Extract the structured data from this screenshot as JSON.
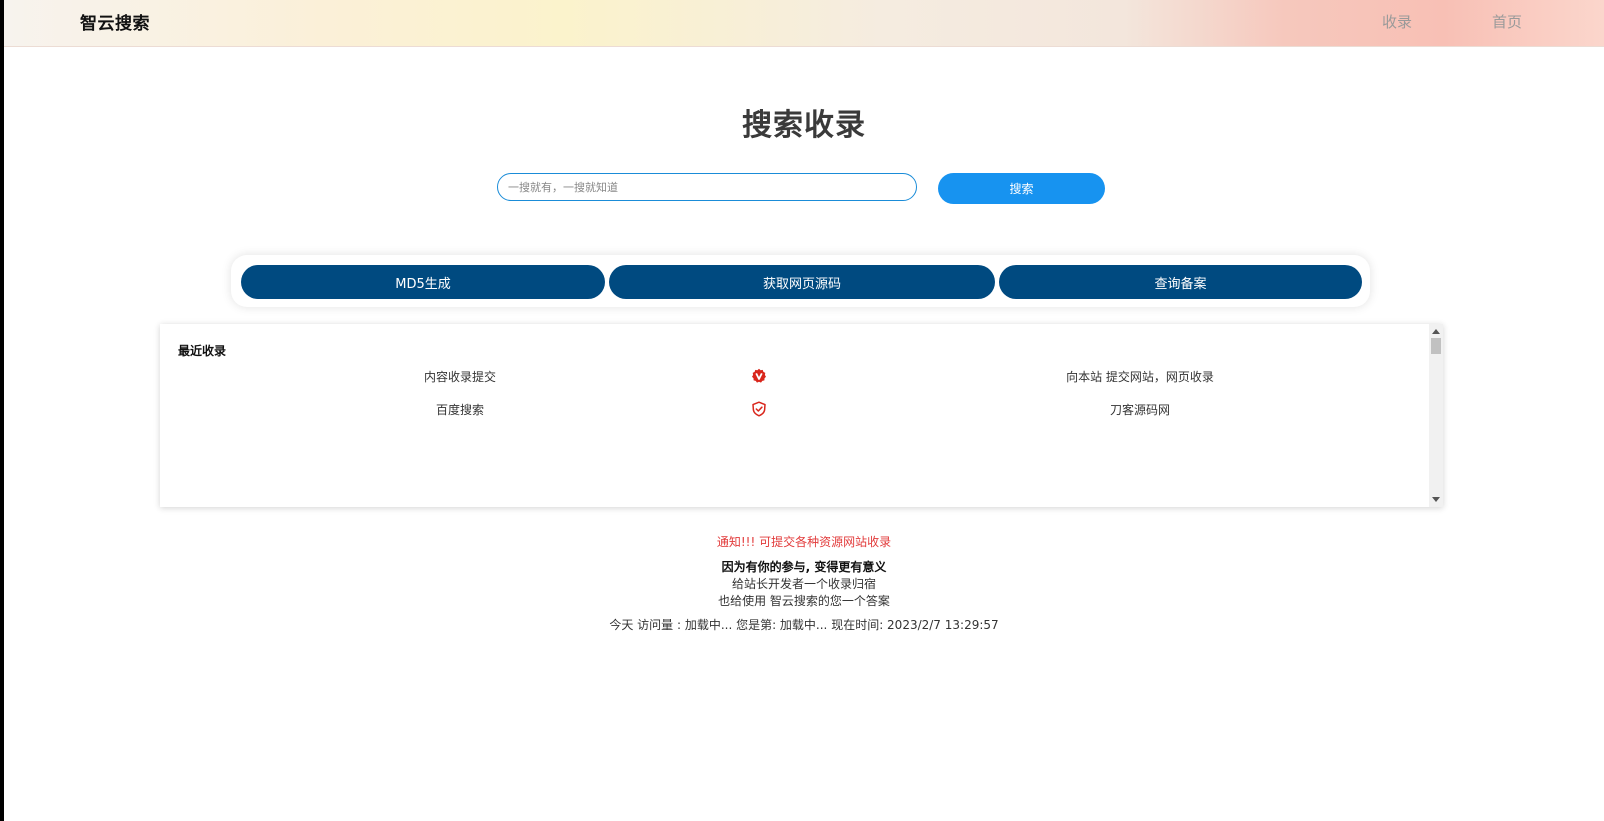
{
  "header": {
    "brand": "智云搜索",
    "nav": [
      {
        "label": "收录"
      },
      {
        "label": "首页"
      }
    ]
  },
  "main": {
    "title": "搜索收录",
    "search": {
      "placeholder": "一搜就有，一搜就知道",
      "value": "",
      "button_label": "搜索"
    },
    "tools": [
      {
        "label": "MD5生成"
      },
      {
        "label": "获取网页源码"
      },
      {
        "label": "查询备案"
      }
    ]
  },
  "recent": {
    "title": "最近收录",
    "items": [
      {
        "name": "内容收录提交",
        "icon": "verified-v-badge-icon",
        "description": "向本站 提交网站，网页收录"
      },
      {
        "name": "百度搜索",
        "icon": "shield-check-icon",
        "description": "刀客源码网"
      }
    ]
  },
  "footer": {
    "notice": "通知!!! 可提交各种资源网站收录",
    "line1": "因为有你的参与, 变得更有意义",
    "line2": "给站长开发者一个收录归宿",
    "line3": "也给使用 智云搜索的您一个答案",
    "stats": "今天 访问量 : 加载中... 您是第: 加载中... 现在时间: 2023/2/7 13:29:57"
  },
  "colors": {
    "accent": "#1793f0",
    "tool_button": "#004a80",
    "notice": "#e23b3b"
  }
}
